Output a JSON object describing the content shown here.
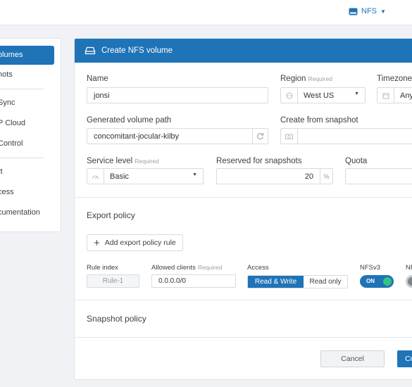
{
  "topbar": {
    "nfs_label": "NFS",
    "nfs_icon": "drive-icon"
  },
  "sidebar": {
    "items": [
      {
        "label": "olumes",
        "active": true
      },
      {
        "label": "hots"
      },
      {
        "label": "Sync"
      },
      {
        "label": "P Cloud"
      },
      {
        "label": "Control"
      },
      {
        "label": "rt"
      },
      {
        "label": "cess"
      },
      {
        "label": "cumentation"
      }
    ]
  },
  "panel": {
    "title": "Create NFS volume",
    "name": {
      "label": "Name",
      "value": "jonsi"
    },
    "region": {
      "label": "Region",
      "required": "Required",
      "value": "West US"
    },
    "timezone": {
      "label": "Timezone",
      "value": "Any"
    },
    "volume_path": {
      "label": "Generated volume path",
      "value": "concomitant-jocular-kilby"
    },
    "snapshot_source": {
      "label": "Create from snapshot",
      "value": ""
    },
    "service_level": {
      "label": "Service level",
      "required": "Required",
      "value": "Basic"
    },
    "reserved": {
      "label": "Reserved for snapshots",
      "value": "20",
      "suffix": "%"
    },
    "quota": {
      "label": "Quota",
      "value": ""
    },
    "export_policy": {
      "title": "Export policy",
      "add_rule_label": "Add export policy rule",
      "columns": {
        "rule_index": "Rule index",
        "allowed_clients": "Allowed clients",
        "allowed_required": "Required",
        "access": "Access",
        "nfsv3": "NFSv3",
        "nfsv4_partial": "NF"
      },
      "rule": {
        "index": "Rule-1",
        "clients": "0.0.0.0/0",
        "access_options": [
          "Read & Write",
          "Read only"
        ],
        "access_selected": "Read & Write",
        "nfsv3_label": "ON",
        "nfsv3_on": true,
        "nfsv4_on": false
      }
    },
    "snapshot_policy": {
      "title": "Snapshot policy"
    },
    "buttons": {
      "cancel": "Cancel",
      "create": "Cr"
    }
  },
  "colors": {
    "accent": "#1f73b7",
    "toggle_knob_on": "#35c480"
  }
}
